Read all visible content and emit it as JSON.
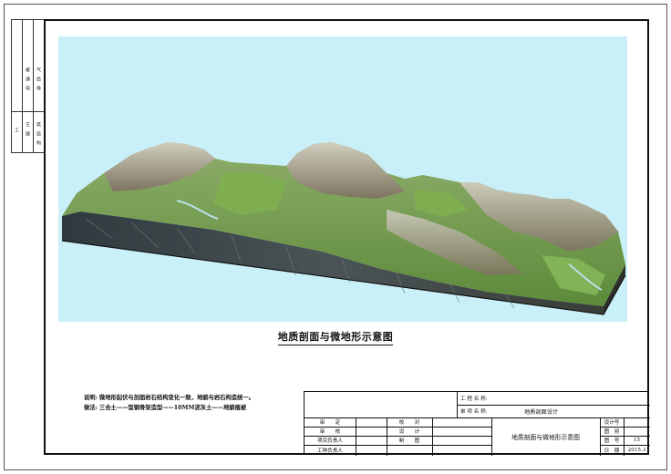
{
  "binding": {
    "top_labels": [
      "暖",
      "通",
      "电",
      "气",
      "给",
      "排"
    ],
    "bottom_labels": [
      "工",
      "艺",
      "建",
      "筑",
      "结",
      "构"
    ]
  },
  "drawing_title": "地质剖面与微地形示意图",
  "notes": {
    "line1_label": "说明:",
    "line1_text": "微地形起伏与剖面岩石结构变化一致，地貌与岩石构造统一。",
    "line2_label": "做法:",
    "line2_text": "三合土——型钢骨架造型——10MM泥灰土——地貌植被"
  },
  "title_block": {
    "project_label": "工 程 名 称:",
    "project_value": "",
    "item_label": "单 项 名 称:",
    "item_value": "地质剖面设计",
    "approve": "审　　定",
    "review": "审　　核",
    "proj_lead": "项目负责人",
    "discipline_lead": "工种负责人",
    "check": "校　　对",
    "design": "设　　计",
    "draw": "制　　图",
    "drawing_name": "地质剖面与微地形示意图",
    "design_no_label": "设计号",
    "drawing_type_label": "图　别",
    "drawing_no_label": "图　号",
    "drawing_no_value": "15",
    "date_label": "日　期",
    "date_value": "2015.3"
  },
  "colors": {
    "sky": "#c9f0f8",
    "grass": "#6aa84f",
    "rock": "#8a7a6a",
    "section": "#2e3a40"
  }
}
